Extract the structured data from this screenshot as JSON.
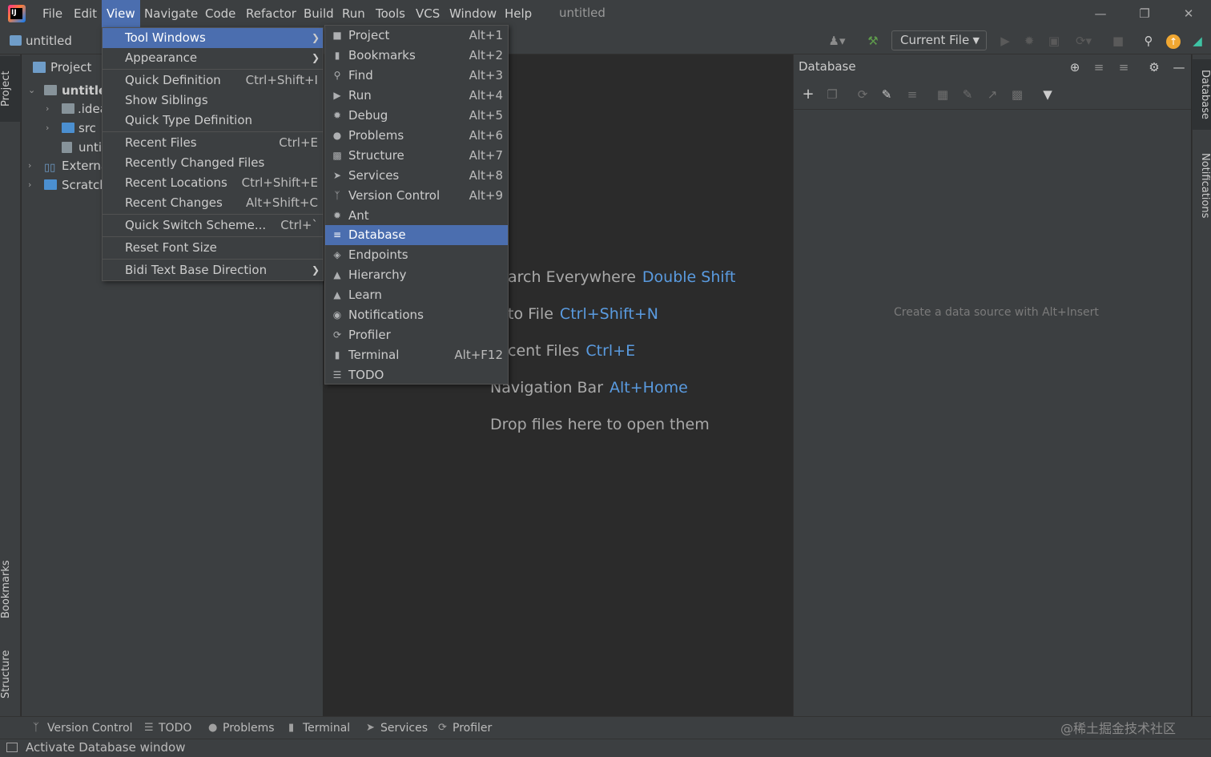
{
  "menubar": {
    "items": [
      "File",
      "Edit",
      "View",
      "Navigate",
      "Code",
      "Refactor",
      "Build",
      "Run",
      "Tools",
      "VCS",
      "Window",
      "Help"
    ],
    "window_title": "untitled"
  },
  "navbar": {
    "project": "untitled",
    "run_config": "Current File"
  },
  "project_panel": {
    "title": "Project",
    "tree": [
      "untitled",
      ".idea",
      "src",
      "unti",
      "Externa",
      "Scratch"
    ]
  },
  "view_menu": {
    "items": [
      {
        "label": "Tool Windows",
        "shortcut": "",
        "submenu": true,
        "selected": true
      },
      {
        "label": "Appearance",
        "shortcut": "",
        "submenu": true
      },
      {
        "label": "Quick Definition",
        "shortcut": "Ctrl+Shift+I"
      },
      {
        "label": "Show Siblings",
        "shortcut": ""
      },
      {
        "label": "Quick Type Definition",
        "shortcut": ""
      },
      {
        "label": "Recent Files",
        "shortcut": "Ctrl+E"
      },
      {
        "label": "Recently Changed Files",
        "shortcut": ""
      },
      {
        "label": "Recent Locations",
        "shortcut": "Ctrl+Shift+E"
      },
      {
        "label": "Recent Changes",
        "shortcut": "Alt+Shift+C"
      },
      {
        "label": "Quick Switch Scheme...",
        "shortcut": "Ctrl+`"
      },
      {
        "label": "Reset Font Size",
        "shortcut": ""
      },
      {
        "label": "Bidi Text Base Direction",
        "shortcut": "",
        "submenu": true
      }
    ]
  },
  "tool_windows_menu": {
    "items": [
      {
        "label": "Project",
        "shortcut": "Alt+1",
        "icon": "folder-icon"
      },
      {
        "label": "Bookmarks",
        "shortcut": "Alt+2",
        "icon": "bookmark-icon"
      },
      {
        "label": "Find",
        "shortcut": "Alt+3",
        "icon": "search-icon"
      },
      {
        "label": "Run",
        "shortcut": "Alt+4",
        "icon": "run-icon"
      },
      {
        "label": "Debug",
        "shortcut": "Alt+5",
        "icon": "bug-icon"
      },
      {
        "label": "Problems",
        "shortcut": "Alt+6",
        "icon": "warning-icon"
      },
      {
        "label": "Structure",
        "shortcut": "Alt+7",
        "icon": "structure-icon"
      },
      {
        "label": "Services",
        "shortcut": "Alt+8",
        "icon": "services-icon"
      },
      {
        "label": "Version Control",
        "shortcut": "Alt+9",
        "icon": "vcs-icon"
      },
      {
        "label": "Ant",
        "shortcut": "",
        "icon": "ant-icon"
      },
      {
        "label": "Database",
        "shortcut": "",
        "icon": "database-icon",
        "selected": true
      },
      {
        "label": "Endpoints",
        "shortcut": "",
        "icon": "endpoints-icon"
      },
      {
        "label": "Hierarchy",
        "shortcut": "",
        "icon": "hierarchy-icon"
      },
      {
        "label": "Learn",
        "shortcut": "",
        "icon": "learn-icon"
      },
      {
        "label": "Notifications",
        "shortcut": "",
        "icon": "bell-icon"
      },
      {
        "label": "Profiler",
        "shortcut": "",
        "icon": "profiler-icon"
      },
      {
        "label": "Terminal",
        "shortcut": "Alt+F12",
        "icon": "terminal-icon"
      },
      {
        "label": "TODO",
        "shortcut": "",
        "icon": "list-icon"
      }
    ]
  },
  "editor_hints": [
    {
      "text": "arch Everywhere",
      "key": "Double Shift"
    },
    {
      "text": "to File",
      "key": "Ctrl+Shift+N"
    },
    {
      "text": "cent Files",
      "key": "Ctrl+E"
    },
    {
      "text": "Navigation Bar",
      "key": "Alt+Home"
    },
    {
      "text": "Drop files here to open them",
      "key": ""
    }
  ],
  "database_panel": {
    "title": "Database",
    "empty_text": "Create a data source with Alt+Insert"
  },
  "side_tabs": {
    "left_top": "Project",
    "left_bookmarks": "Bookmarks",
    "left_structure": "Structure",
    "right_database": "Database",
    "right_notifications": "Notifications"
  },
  "bottom_tools": [
    "Version Control",
    "TODO",
    "Problems",
    "Terminal",
    "Services",
    "Profiler"
  ],
  "status_text": "Activate Database window",
  "watermark": "@稀土掘金技术社区",
  "colors": {
    "accent": "#4b6eaf",
    "shortcut_key": "#5a9be0",
    "background": "#2b2b2b",
    "panel": "#3c3f41"
  }
}
